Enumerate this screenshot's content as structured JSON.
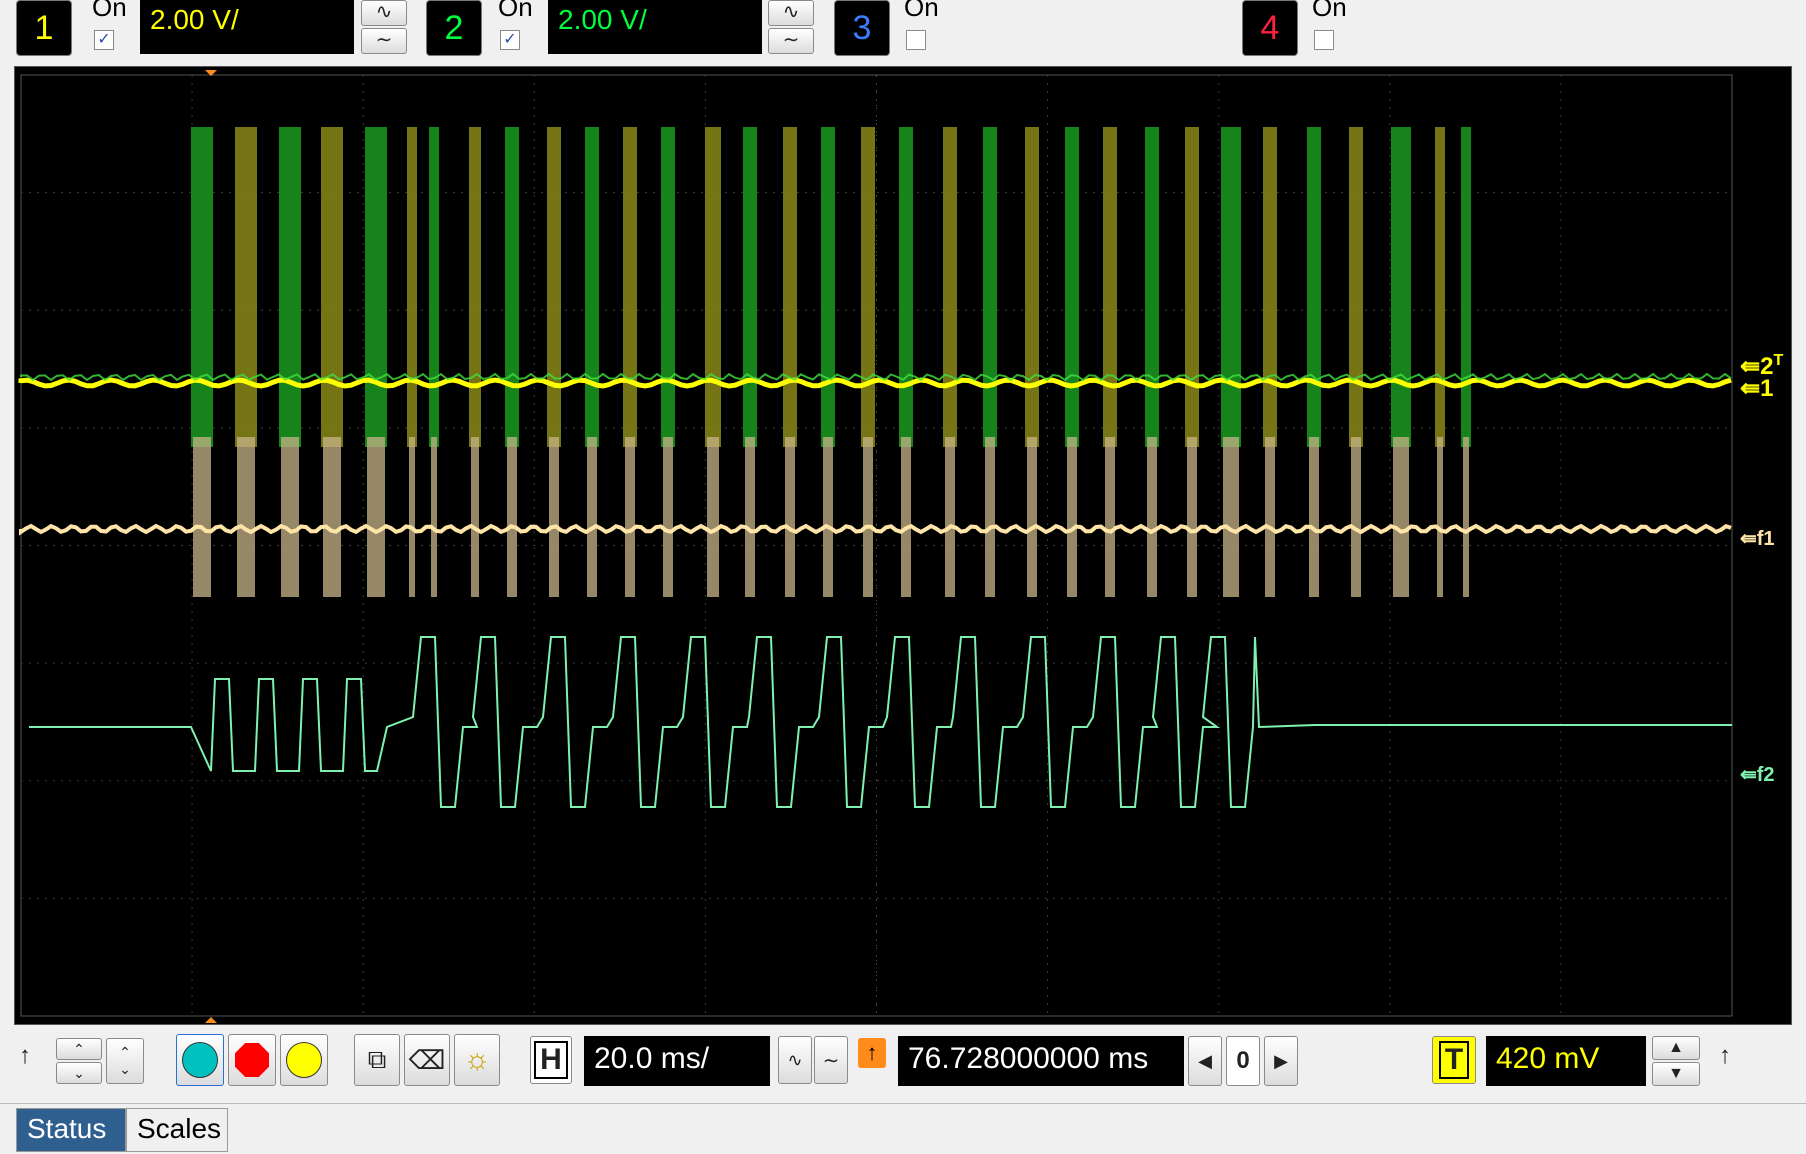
{
  "channels": [
    {
      "num": "1",
      "on_label": "On",
      "checked": true,
      "vdiv": "2.00 V/",
      "color": "#ffff00"
    },
    {
      "num": "2",
      "on_label": "On",
      "checked": true,
      "vdiv": "2.00 V/",
      "color": "#00ff3c"
    },
    {
      "num": "3",
      "on_label": "On",
      "checked": false,
      "color": "#3c7cff"
    },
    {
      "num": "4",
      "on_label": "On",
      "checked": false,
      "color": "#ff2040"
    }
  ],
  "markers": {
    "ch2": "2",
    "trigger_level": "T",
    "ch1": "1",
    "f1": "f1",
    "f2": "f2"
  },
  "timebase": {
    "h_label": "H",
    "value": "20.0 ms/"
  },
  "delay": {
    "value": "76.728000000 ms",
    "center": "0"
  },
  "trigger": {
    "t_label": "T",
    "level": "420 mV"
  },
  "tabs": [
    "Status",
    "Scales"
  ],
  "colors": {
    "ch1": "#ffff00",
    "ch2": "#00c020",
    "f1": "#ffe4a8",
    "f2": "#7ff0b0",
    "grid": "#3a3a3a"
  }
}
